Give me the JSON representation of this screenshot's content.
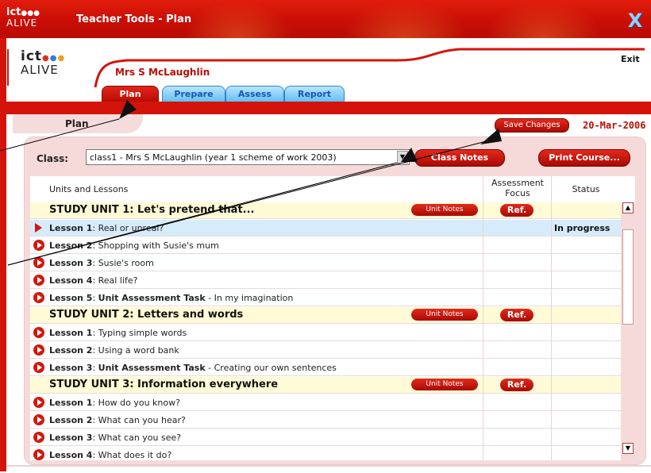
{
  "window": {
    "title": "Teacher Tools - Plan",
    "logo_line1": "ict",
    "logo_line2": "ALIVE",
    "close_label": "X"
  },
  "header": {
    "logo_line1": "ict",
    "logo_line2": "ALIVE",
    "user_name": "Mrs S McLaughlin",
    "exit_label": "Exit",
    "tabs": [
      {
        "label": "Plan",
        "active": true
      },
      {
        "label": "Prepare"
      },
      {
        "label": "Assess"
      },
      {
        "label": "Report"
      }
    ],
    "section_label": "Plan",
    "save_label": "Save Changes",
    "date": "20-Mar-2006"
  },
  "class_bar": {
    "label": "Class:",
    "selected": "class1 - Mrs S McLaughlin (year 1 scheme of work 2003)",
    "class_notes_label": "Class Notes",
    "print_label": "Print Course..."
  },
  "grid": {
    "col_units": "Units and Lessons",
    "col_focus_1": "Assessment",
    "col_focus_2": "Focus",
    "col_status": "Status",
    "unit_notes_label": "Unit Notes",
    "ref_label": "Ref.",
    "rows": [
      {
        "type": "unit",
        "text": "STUDY UNIT 1: Let's pretend that..."
      },
      {
        "type": "lesson",
        "num": "Lesson 1",
        "text": ": Real or unreal?",
        "status": "In progress",
        "selected": true
      },
      {
        "type": "lesson",
        "num": "Lesson 2",
        "text": ": Shopping with Susie's mum"
      },
      {
        "type": "lesson",
        "num": "Lesson 3",
        "text": ": Susie's room"
      },
      {
        "type": "lesson",
        "num": "Lesson 4",
        "text": ": Real life?"
      },
      {
        "type": "lesson",
        "num": "Lesson 5",
        "text": ": ",
        "bold2": "Unit Assessment Task",
        "text2": " - In my imagination"
      },
      {
        "type": "unit",
        "text": "STUDY UNIT 2: Letters and words"
      },
      {
        "type": "lesson",
        "num": "Lesson 1",
        "text": ": Typing simple words"
      },
      {
        "type": "lesson",
        "num": "Lesson 2",
        "text": ": Using a word bank"
      },
      {
        "type": "lesson",
        "num": "Lesson 3",
        "text": ": ",
        "bold2": "Unit Assessment Task",
        "text2": " - Creating our own sentences"
      },
      {
        "type": "unit",
        "text": "STUDY UNIT 3: Information everywhere"
      },
      {
        "type": "lesson",
        "num": "Lesson 1",
        "text": ": How do you know?"
      },
      {
        "type": "lesson",
        "num": "Lesson 2",
        "text": ": What can you hear?"
      },
      {
        "type": "lesson",
        "num": "Lesson 3",
        "text": ": What can you see?"
      },
      {
        "type": "lesson",
        "num": "Lesson 4",
        "text": ": What does it do?"
      }
    ]
  },
  "colors": {
    "brand_red": "#d4140a",
    "tab_blue": "#64bff1",
    "unit_row": "#fffbd6",
    "selected_row": "#d6ecfa"
  }
}
